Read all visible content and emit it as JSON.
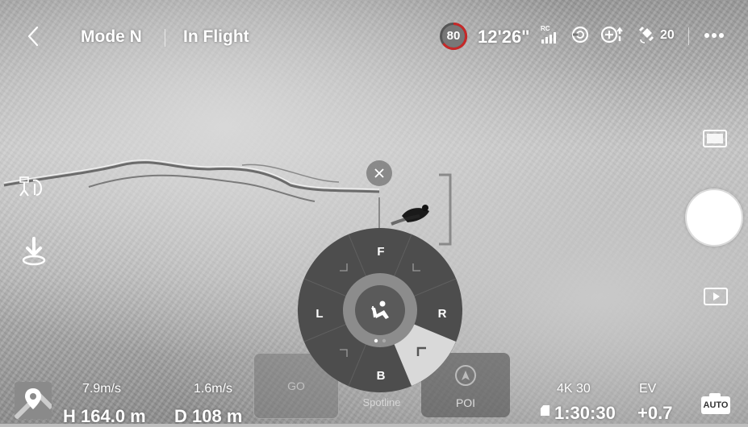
{
  "header": {
    "back_icon": "chevron-left-icon",
    "mode": "Mode N",
    "status": "In Flight",
    "battery_percent": "80",
    "flight_time": "12'26\"",
    "rc_label": "RC",
    "satellites": "20",
    "more_icon": "more-dots-icon"
  },
  "left_tools": {
    "track_icon": "smart-track-icon",
    "landing_icon": "landing-icon"
  },
  "right_tools": {
    "camera_mode_icon": "camera-mode-icon",
    "shutter_icon": "shutter-button",
    "playback_icon": "play-icon",
    "auto_label": "AUTO"
  },
  "target": {
    "close_icon": "close-icon"
  },
  "wheel": {
    "labels": {
      "front": "F",
      "back": "B",
      "left": "L",
      "right": "R"
    },
    "center_icon": "subject-icon",
    "active_sector": "back-right"
  },
  "bottom_modes": [
    {
      "label": "GO"
    },
    {
      "label": "Spotline"
    },
    {
      "label": "POI"
    }
  ],
  "telemetry": {
    "h_speed": "7.9m/s",
    "v_speed": "1.6m/s",
    "height": "H 164.0 m",
    "distance": "D 108 m"
  },
  "camera_info": {
    "resolution": "4K 30",
    "ev_label": "EV",
    "remaining": "1:30:30",
    "ev_value": "+0.7"
  },
  "map_icon": "map-pin-icon",
  "colors": {
    "wheel_bg": "#4d4d4d",
    "wheel_active": "#d9d9d9",
    "text": "#ffffff"
  }
}
